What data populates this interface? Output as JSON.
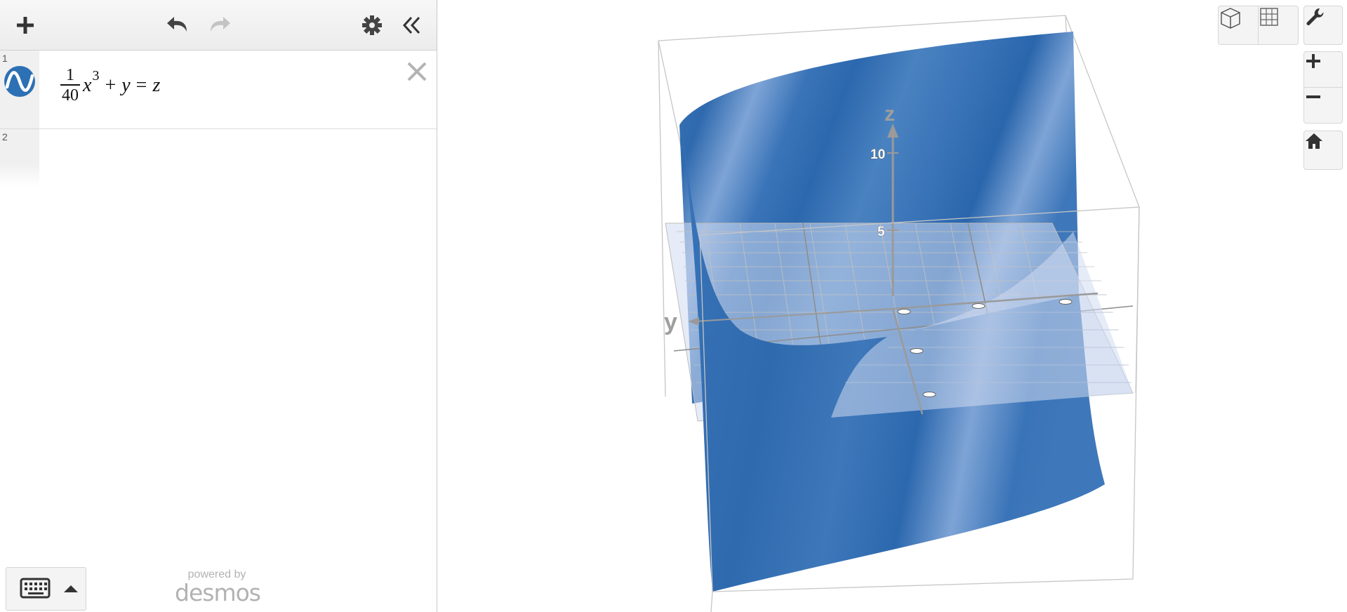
{
  "toolbar": {
    "add_icon": "plus-icon",
    "undo_icon": "undo-icon",
    "redo_icon": "redo-icon",
    "settings_icon": "gear-icon",
    "collapse_icon": "double-chevron-left-icon"
  },
  "expressions": [
    {
      "index": "1",
      "icon": "wave-icon",
      "icon_color": "#2d70b3",
      "latex": "\\frac{1}{40}x^3+y=z",
      "frac_num": "1",
      "frac_den": "40",
      "var_x": "x",
      "exp": "3",
      "op_plus": "+",
      "var_y": "y",
      "op_eq": "=",
      "var_z": "z"
    },
    {
      "index": "2",
      "latex": ""
    }
  ],
  "footer": {
    "keyboard_icon": "keyboard-icon",
    "caret_icon": "caret-up-icon",
    "powered_by": "powered by",
    "brand": "desmos"
  },
  "graph": {
    "surface_color": "#2d70b3",
    "axis_z_label": "z",
    "axis_y_label": "y",
    "z_ticks": [
      "10",
      "5"
    ],
    "controls": {
      "view_3d_icon": "cube-icon",
      "view_2d_icon": "grid-icon",
      "settings_icon": "wrench-icon",
      "zoom_in_icon": "plus-icon",
      "zoom_out_icon": "minus-icon",
      "home_icon": "home-icon"
    }
  }
}
